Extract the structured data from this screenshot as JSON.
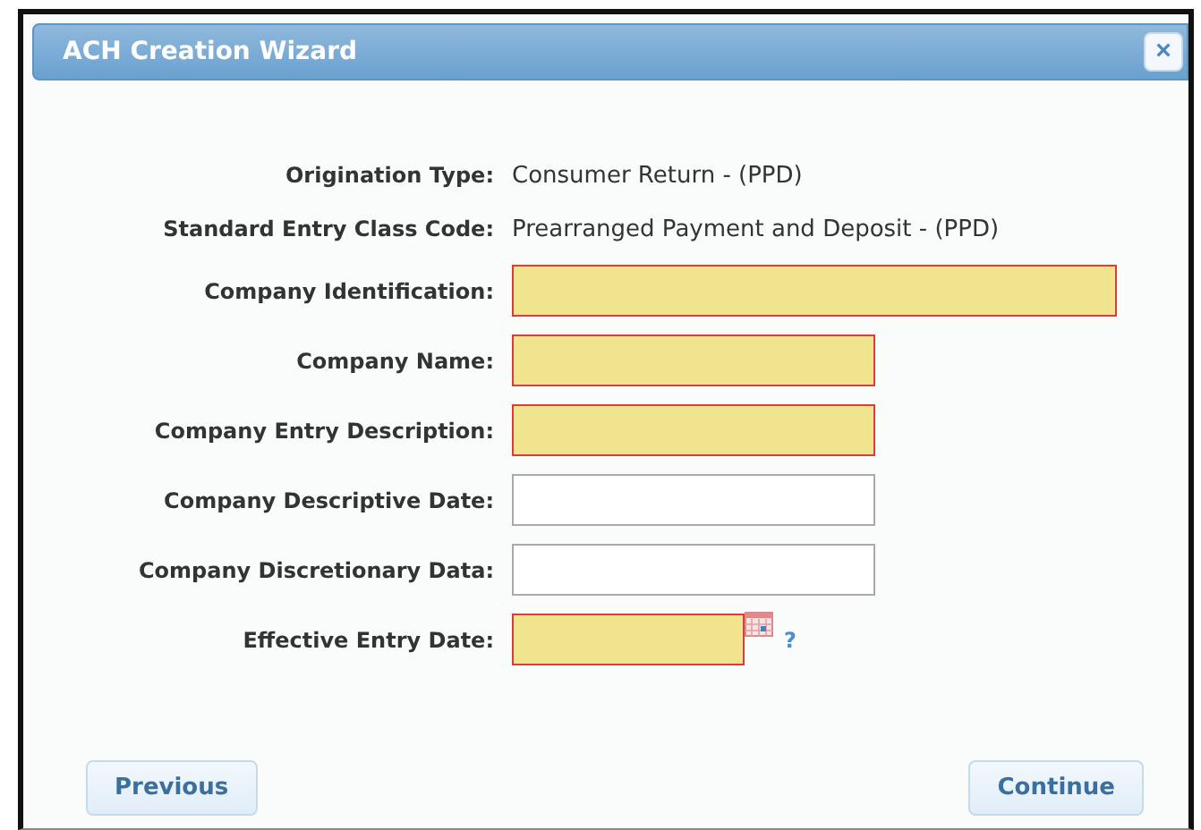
{
  "window": {
    "title": "ACH Creation Wizard",
    "close": "×"
  },
  "fields": [
    {
      "label": "Origination Type:",
      "kind": "text",
      "value": "Consumer Return - (PPD)"
    },
    {
      "label": "Standard Entry Class Code:",
      "kind": "text",
      "value": "Prearranged Payment and Deposit - (PPD)"
    },
    {
      "label": "Company Identification:",
      "kind": "wide_input",
      "required": true
    },
    {
      "label": "Company Name:",
      "kind": "input",
      "required": true
    },
    {
      "label": "Company Entry Description:",
      "kind": "input",
      "required": true
    },
    {
      "label": "Company Descriptive Date:",
      "kind": "input",
      "required": false
    },
    {
      "label": "Company Discretionary Data:",
      "kind": "input",
      "required": false
    },
    {
      "label": "Effective Entry Date:",
      "kind": "date",
      "required": true,
      "help": "?"
    }
  ],
  "buttons": [
    "Previous",
    "Continue"
  ]
}
